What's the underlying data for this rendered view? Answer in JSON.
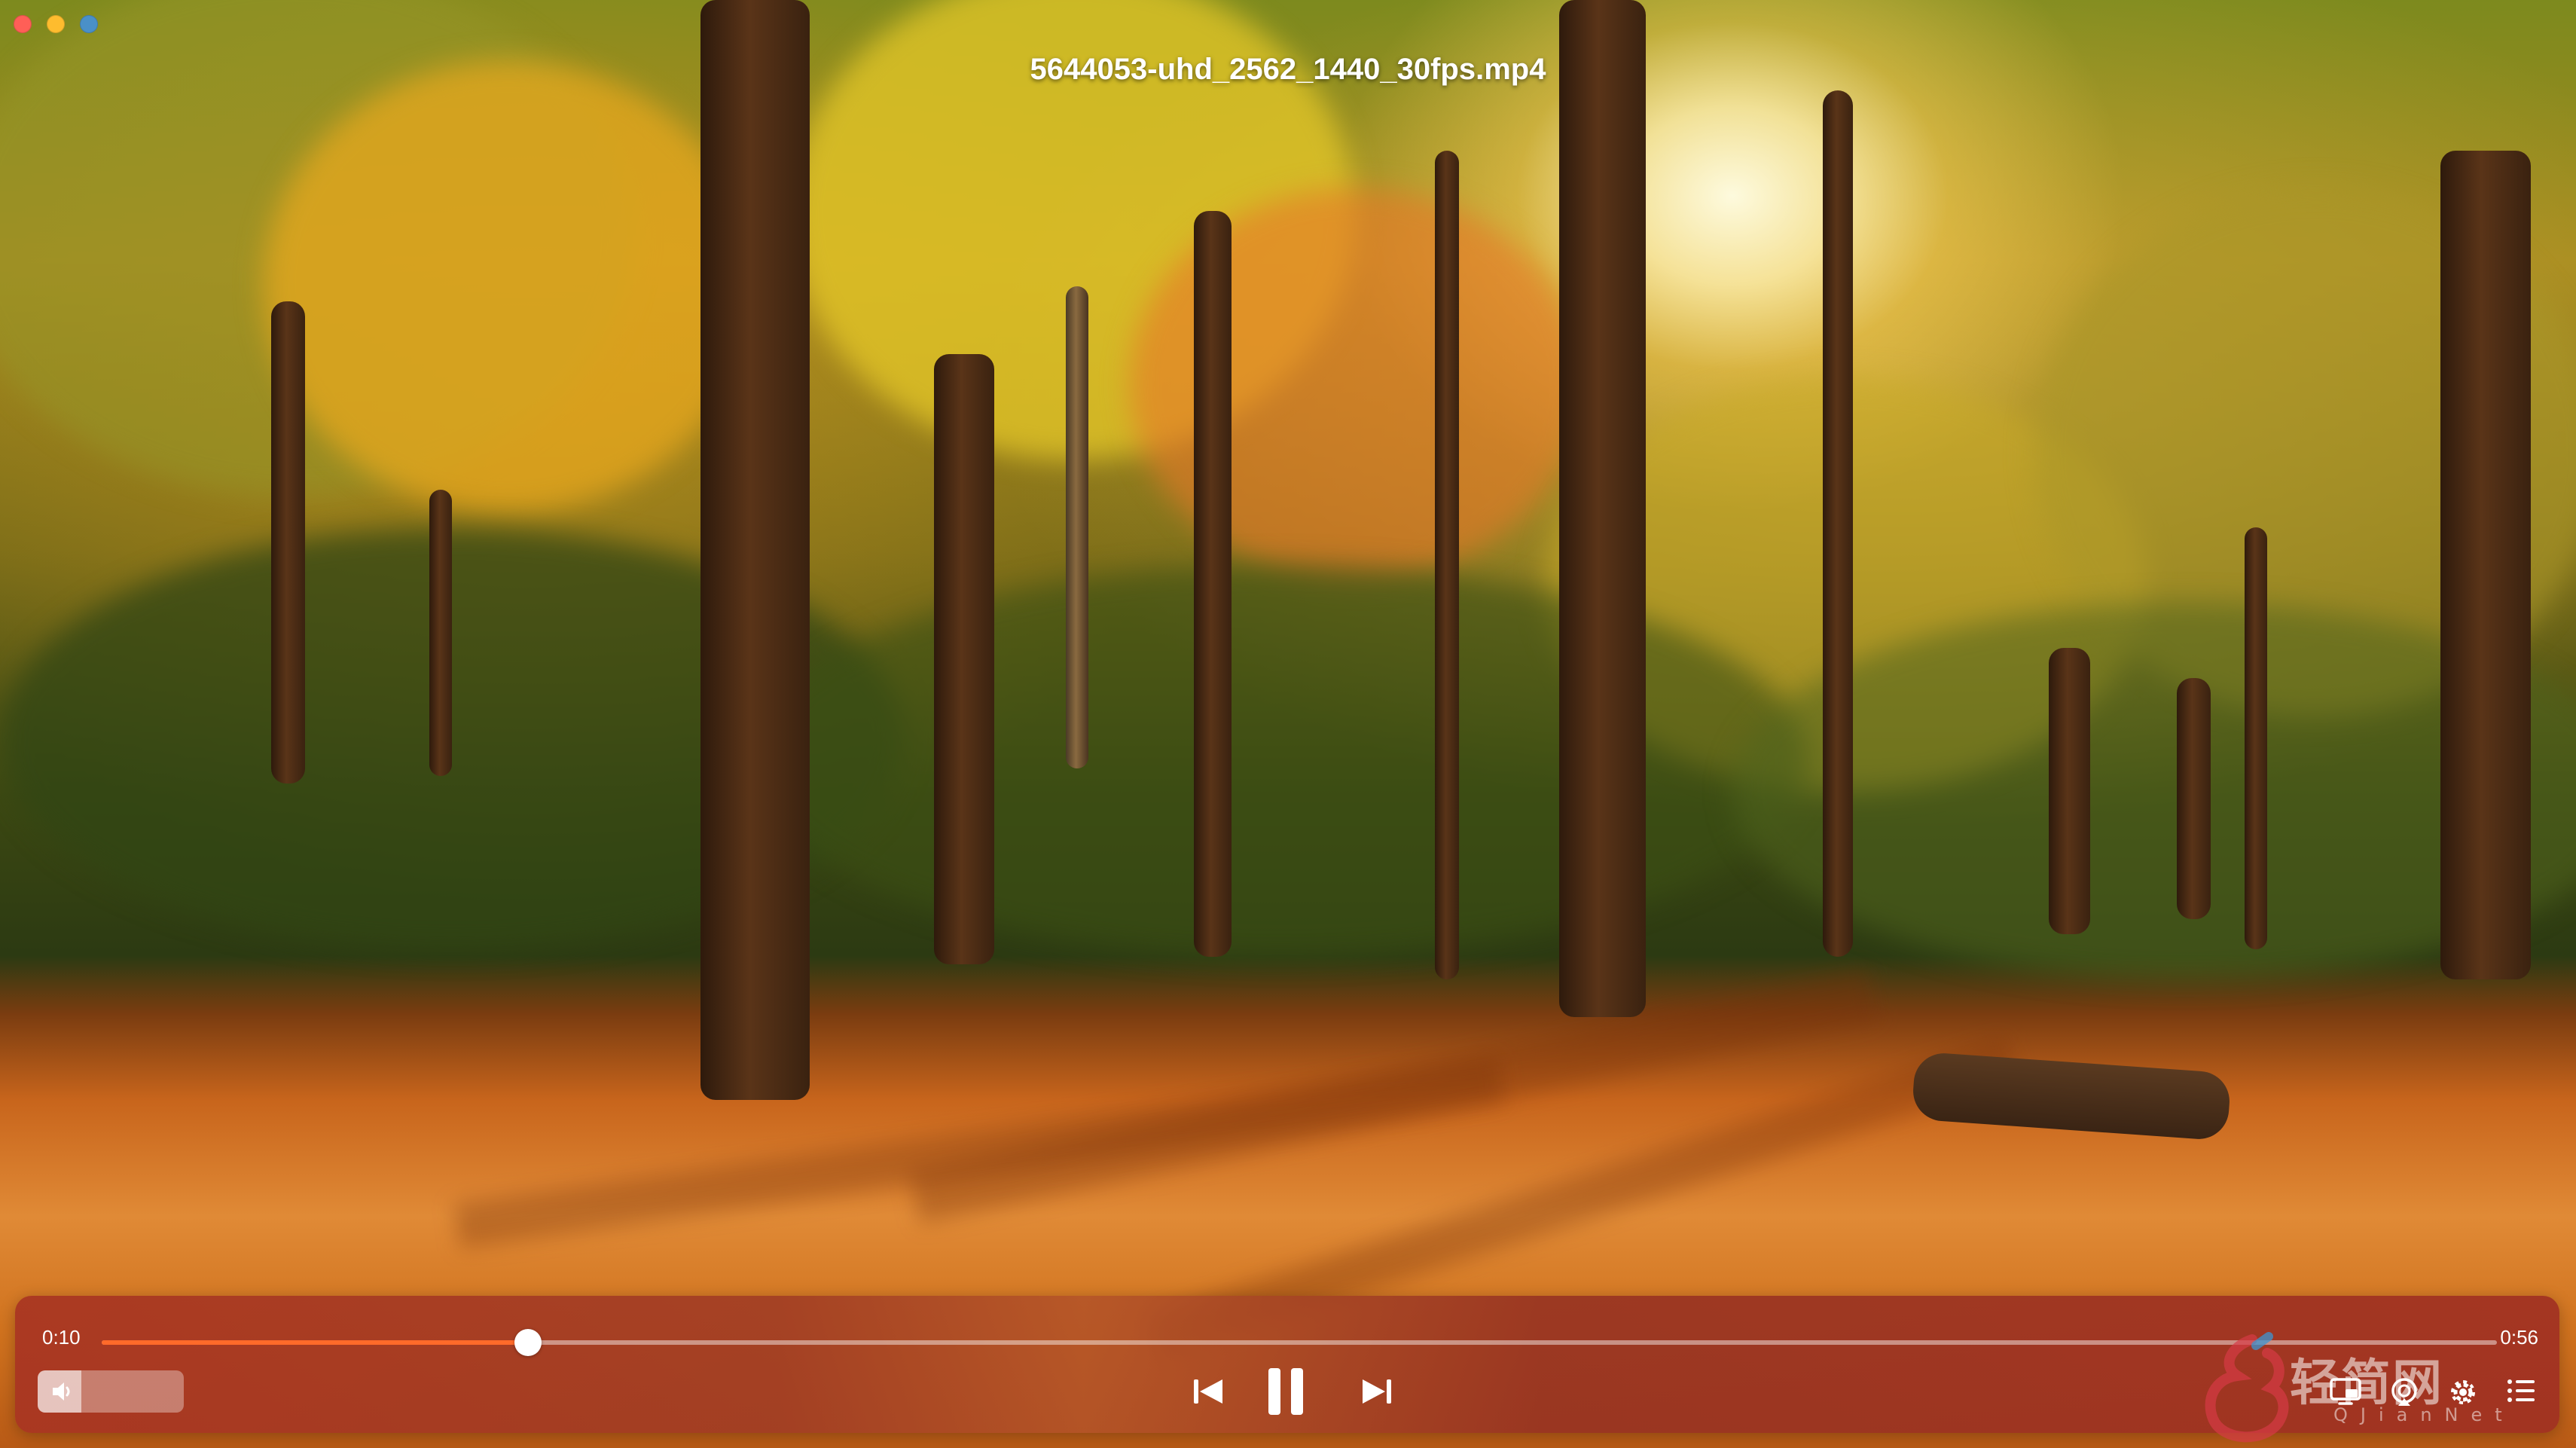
{
  "window": {
    "title": "5644053-uhd_2562_1440_30fps.mp4",
    "traffic_lights": {
      "close_color": "#ff5f57",
      "minimize_color": "#febc2e",
      "zoom_color": "#4a90c8"
    }
  },
  "video": {
    "scene": "autumn forest"
  },
  "player": {
    "current_time": "0:10",
    "total_time": "0:56",
    "progress_fraction": 0.178,
    "volume_fraction": 0.3,
    "accent_color": "#ff6a2a",
    "icons": {
      "volume": "speaker-icon",
      "previous": "skip-back-icon",
      "play_pause": "pause-icon",
      "next": "skip-forward-icon",
      "picture_in_picture": "pip-icon",
      "airplay": "airplay-icon",
      "settings": "gear-icon",
      "playlist": "list-icon"
    }
  },
  "watermark": {
    "text": "轻简网",
    "subtext": "QJianNet"
  }
}
